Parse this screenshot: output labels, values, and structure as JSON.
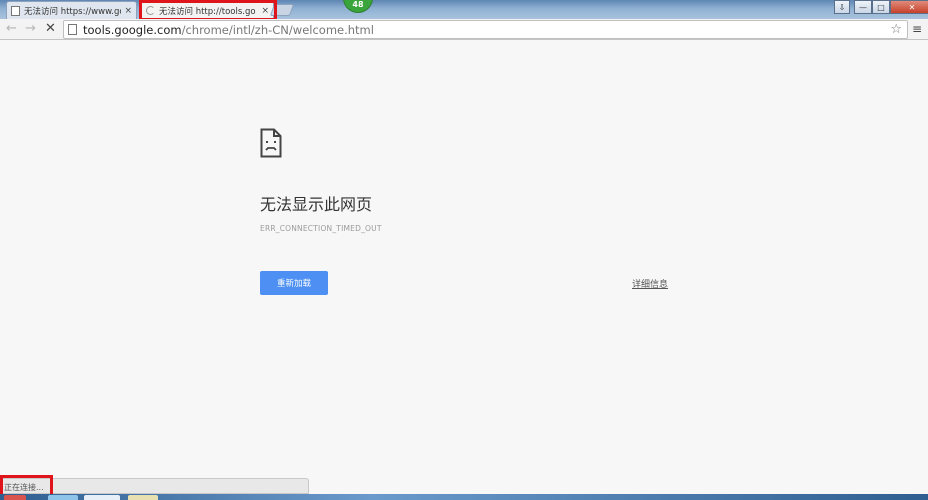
{
  "tabs": [
    {
      "title": "无法访问 https://www.go",
      "close": "×",
      "active": false
    },
    {
      "title": "无法访问 http://tools.go",
      "close": "×",
      "active": true
    }
  ],
  "extension_badge": "48",
  "window_controls": {
    "restore": "⇩",
    "minimize": "—",
    "maximize": "□",
    "close": "✕"
  },
  "toolbar": {
    "back": "←",
    "forward": "→",
    "stop": "✕",
    "url_host": "tools.google.com",
    "url_path": "/chrome/intl/zh-CN/welcome.html",
    "star": "☆",
    "menu": "≡"
  },
  "error_page": {
    "heading": "无法显示此网页",
    "error_code": "ERR_CONNECTION_TIMED_OUT",
    "reload_button": "重新加载",
    "details_link": "详细信息"
  },
  "status_bar": {
    "text": "正在连接..."
  },
  "colors": {
    "accent": "#4d8ff2",
    "highlight": "#e0141b",
    "badge": "#3aa53c"
  }
}
